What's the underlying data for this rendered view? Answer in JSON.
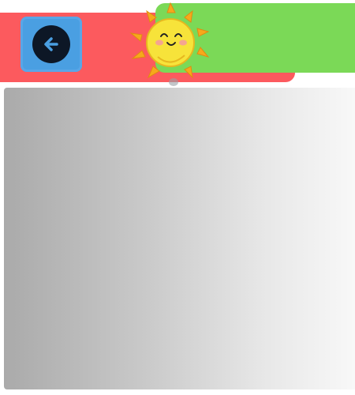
{
  "header": {
    "back_button": {
      "icon": "arrow-left-icon"
    },
    "sun": {
      "icon": "smiling-sun-icon"
    }
  },
  "colors": {
    "header_red": "#fc5a5e",
    "header_green": "#7bd957",
    "back_button_bg": "#4a9fe2",
    "back_icon_circle": "#0d1726",
    "sun_yellow": "#f7e33a",
    "sun_rays": "#f6a91b",
    "panel_gradient_start": "#aaaaaa",
    "panel_gradient_end": "#f8f8f8"
  }
}
